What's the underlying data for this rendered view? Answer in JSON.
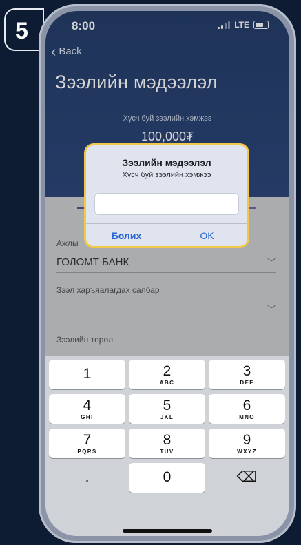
{
  "step": {
    "number": "5"
  },
  "status_bar": {
    "time": "8:00",
    "network": "LTE"
  },
  "nav": {
    "back_label": "Back"
  },
  "page": {
    "title": "Зээлийн мэдээлэл"
  },
  "loan": {
    "amount_label": "Хүсч буй зээлийн хэмжээ",
    "amount_value": "100,000₮"
  },
  "form": {
    "employer_label": "Ажлы",
    "employer_value": "ГОЛОМТ БАНК",
    "branch_label": "Зээл харъяалагдах салбар",
    "branch_value": "",
    "loan_type_label": "Зээлийн төрөл"
  },
  "alert": {
    "title": "Зээлийн мэдээлэл",
    "message": "Хүсч буй зээлийн хэмжээ",
    "input_value": "",
    "cancel_label": "Болих",
    "ok_label": "OK"
  },
  "keyboard": {
    "keys": [
      {
        "num": "1",
        "letters": ""
      },
      {
        "num": "2",
        "letters": "ABC"
      },
      {
        "num": "3",
        "letters": "DEF"
      },
      {
        "num": "4",
        "letters": "GHI"
      },
      {
        "num": "5",
        "letters": "JKL"
      },
      {
        "num": "6",
        "letters": "MNO"
      },
      {
        "num": "7",
        "letters": "PQRS"
      },
      {
        "num": "8",
        "letters": "TUV"
      },
      {
        "num": "9",
        "letters": "WXYZ"
      },
      {
        "num": ".",
        "letters": ""
      },
      {
        "num": "0",
        "letters": ""
      },
      {
        "num": "⌫",
        "letters": ""
      }
    ]
  },
  "colors": {
    "header_bg": "#0f2a5c",
    "alert_border": "#f2c84b",
    "alert_button": "#2a63d4"
  }
}
